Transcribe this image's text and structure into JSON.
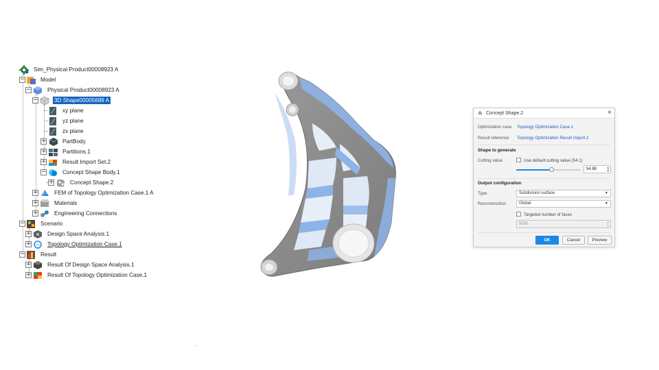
{
  "tree": {
    "nodes": [
      {
        "label": "Sim_Physical Product00008923 A",
        "icon": "simulation-gear-icon"
      },
      {
        "label": "Model",
        "icon": "model-icon"
      },
      {
        "label": "Physical Product00008923 A",
        "icon": "physical-product-icon"
      },
      {
        "label": "3D Shape00005689 A",
        "icon": "3d-shape-icon"
      },
      {
        "label": "xy plane",
        "icon": "plane-icon"
      },
      {
        "label": "yz plane",
        "icon": "plane-icon"
      },
      {
        "label": "zx plane",
        "icon": "plane-icon"
      },
      {
        "label": "PartBody",
        "icon": "part-body-icon"
      },
      {
        "label": "Partitions.1",
        "icon": "partitions-icon"
      },
      {
        "label": "Result Import Set.2",
        "icon": "result-import-icon"
      },
      {
        "label": "Concept Shape Body.1",
        "icon": "concept-body-icon"
      },
      {
        "label": "Concept Shape.2",
        "icon": "concept-shape-icon"
      },
      {
        "label": "FEM of Topology Optimization Case.1 A",
        "icon": "fem-icon"
      },
      {
        "label": "Materials",
        "icon": "materials-icon"
      },
      {
        "label": "Engineering Connections",
        "icon": "connections-icon"
      },
      {
        "label": "Scenario",
        "icon": "scenario-icon"
      },
      {
        "label": "Design Space Analysis.1",
        "icon": "design-space-icon"
      },
      {
        "label": "Topology Optimization Case.1",
        "icon": "topology-case-icon"
      },
      {
        "label": "Result",
        "icon": "result-icon"
      },
      {
        "label": "Result Of Design Space Analysis.1",
        "icon": "design-result-icon"
      },
      {
        "label": "Result Of Topology Optimization Case.1",
        "icon": "topology-result-icon"
      }
    ]
  },
  "viewport": {
    "dots": "..",
    "colors": {
      "part": "#8e8e8e",
      "optimized": "#8db4e8",
      "hole": "#e9e9e9"
    }
  },
  "dialog": {
    "title": "Concept Shape.2",
    "optimization_case_label": "Optimization case",
    "optimization_case_value": "Topology Optimization Case.1",
    "result_reference_label": "Result reference",
    "result_reference_value": "Topology Optimization Result Import.2",
    "shape_section": "Shape to generate",
    "cutting_value_label": "Cutting value",
    "use_default_label": "Use default cutting value (54.1)",
    "use_default_checked": false,
    "slider_fraction": 0.55,
    "cutting_value": "54.88",
    "output_section": "Output configuration",
    "type_label": "Type",
    "type_value": "Subdivision surface",
    "reconstruction_label": "Reconstruction",
    "reconstruction_value": "Global",
    "targeted_faces_label": "Targeted number of faces",
    "targeted_faces_checked": false,
    "faces_value": "5000",
    "ok_label": "OK",
    "cancel_label": "Cancel",
    "preview_label": "Preview",
    "accent": "#1e88e5"
  }
}
